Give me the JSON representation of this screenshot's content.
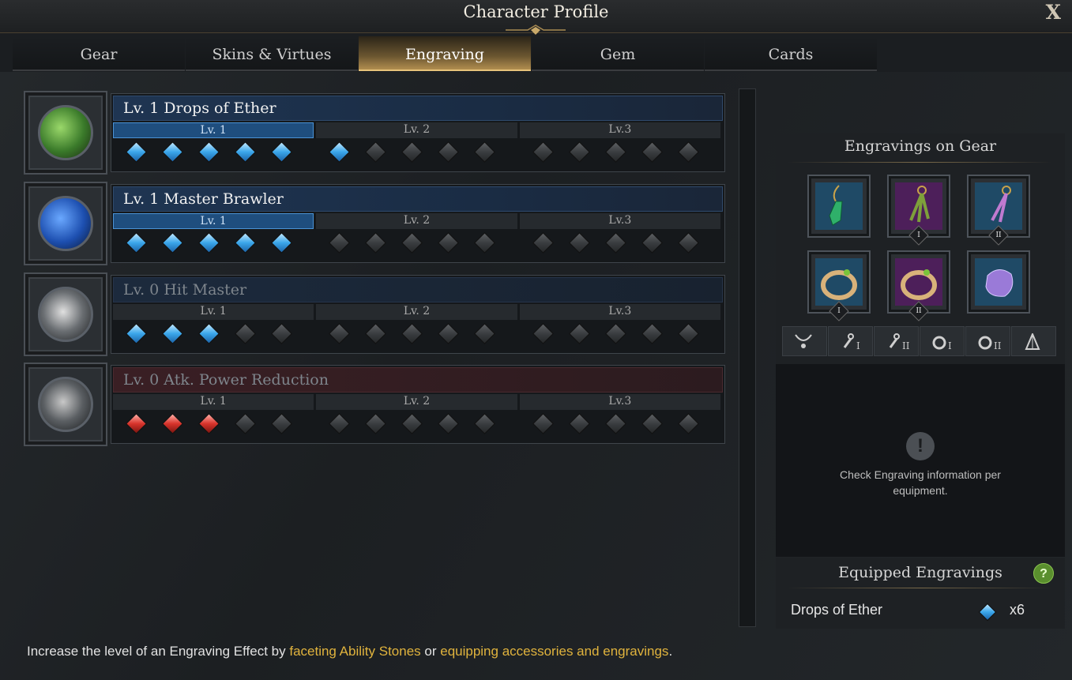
{
  "window": {
    "title": "Character Profile",
    "close_label": "X"
  },
  "tabs": [
    {
      "label": "Gear",
      "active": false
    },
    {
      "label": "Skins & Virtues",
      "active": false
    },
    {
      "label": "Engraving",
      "active": true
    },
    {
      "label": "Gem",
      "active": false
    },
    {
      "label": "Cards",
      "active": false
    }
  ],
  "engravings": [
    {
      "name": "Lv. 1 Drops of Ether",
      "style": "active",
      "levels": [
        {
          "label": "Lv. 1",
          "highlight": true,
          "gems": [
            "blue",
            "blue",
            "blue",
            "blue",
            "blue"
          ]
        },
        {
          "label": "Lv. 2",
          "highlight": false,
          "gems": [
            "blue",
            "gray",
            "gray",
            "gray",
            "gray"
          ]
        },
        {
          "label": "Lv.3",
          "highlight": false,
          "gems": [
            "gray",
            "gray",
            "gray",
            "gray",
            "gray"
          ]
        }
      ]
    },
    {
      "name": "Lv. 1 Master Brawler",
      "style": "active",
      "levels": [
        {
          "label": "Lv. 1",
          "highlight": true,
          "gems": [
            "blue",
            "blue",
            "blue",
            "blue",
            "blue"
          ]
        },
        {
          "label": "Lv. 2",
          "highlight": false,
          "gems": [
            "gray",
            "gray",
            "gray",
            "gray",
            "gray"
          ]
        },
        {
          "label": "Lv.3",
          "highlight": false,
          "gems": [
            "gray",
            "gray",
            "gray",
            "gray",
            "gray"
          ]
        }
      ]
    },
    {
      "name": "Lv. 0 Hit Master",
      "style": "dim",
      "levels": [
        {
          "label": "Lv. 1",
          "highlight": false,
          "gems": [
            "blue",
            "blue",
            "blue",
            "gray",
            "gray"
          ]
        },
        {
          "label": "Lv. 2",
          "highlight": false,
          "gems": [
            "gray",
            "gray",
            "gray",
            "gray",
            "gray"
          ]
        },
        {
          "label": "Lv.3",
          "highlight": false,
          "gems": [
            "gray",
            "gray",
            "gray",
            "gray",
            "gray"
          ]
        }
      ]
    },
    {
      "name": "Lv. 0 Atk. Power Reduction",
      "style": "red",
      "levels": [
        {
          "label": "Lv. 1",
          "highlight": false,
          "gems": [
            "red",
            "red",
            "red",
            "gray",
            "gray"
          ]
        },
        {
          "label": "Lv. 2",
          "highlight": false,
          "gems": [
            "gray",
            "gray",
            "gray",
            "gray",
            "gray"
          ]
        },
        {
          "label": "Lv.3",
          "highlight": false,
          "gems": [
            "gray",
            "gray",
            "gray",
            "gray",
            "gray"
          ]
        }
      ]
    }
  ],
  "footer": {
    "prefix": "Increase the level of an Engraving Effect by ",
    "link1": "faceting Ability Stones",
    "middle": " or ",
    "link2": "equipping accessories and engravings",
    "suffix": "."
  },
  "gear_panel": {
    "title": "Engravings on Gear",
    "slots": [
      {
        "icon": "necklace-icon",
        "roman": ""
      },
      {
        "icon": "earring-icon",
        "roman": "I"
      },
      {
        "icon": "earring-icon",
        "roman": "II"
      },
      {
        "icon": "ring-icon",
        "roman": "I"
      },
      {
        "icon": "ring-icon",
        "roman": "II"
      },
      {
        "icon": "ability-stone-icon",
        "roman": ""
      }
    ],
    "filters": [
      {
        "icon": "necklace-filter-icon",
        "sub": ""
      },
      {
        "icon": "earring-filter-icon",
        "sub": "I"
      },
      {
        "icon": "earring-filter-icon",
        "sub": "II"
      },
      {
        "icon": "ring-filter-icon",
        "sub": "I"
      },
      {
        "icon": "ring-filter-icon",
        "sub": "II"
      },
      {
        "icon": "stone-filter-icon",
        "sub": ""
      }
    ],
    "info_icon": "!",
    "info_text": "Check Engraving information per equipment."
  },
  "equipped": {
    "title": "Equipped Engravings",
    "help_label": "?",
    "items": [
      {
        "name": "Drops of Ether",
        "count": "x6"
      }
    ]
  },
  "colors": {
    "accent_gold": "#e0b33d",
    "gem_blue": "#3aa6ea",
    "gem_red": "#d8332b",
    "tab_active": "#b08d4f"
  }
}
